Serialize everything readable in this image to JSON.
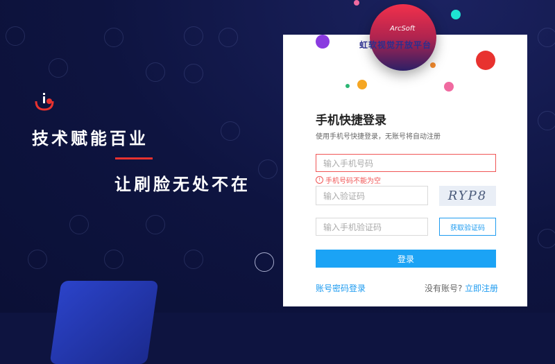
{
  "hero": {
    "line1": "技术赋能百业",
    "line2": "让刷脸无处不在"
  },
  "banner": {
    "brand": "ArcSoft",
    "platform": "虹软视觉开放平台"
  },
  "login": {
    "title": "手机快捷登录",
    "subtitle": "使用手机号快捷登录，无账号将自动注册",
    "phone_placeholder": "输入手机号码",
    "phone_error": "手机号码不能为空",
    "captcha_placeholder": "输入验证码",
    "captcha_text": "RYP8",
    "sms_placeholder": "输入手机验证码",
    "sms_button": "获取验证码",
    "submit": "登录",
    "password_login": "账号密码登录",
    "no_account": "没有账号?",
    "register": "立即注册"
  },
  "colors": {
    "accent": "#1ba3f5",
    "error": "#f05454",
    "brand_red": "#e8322f"
  }
}
